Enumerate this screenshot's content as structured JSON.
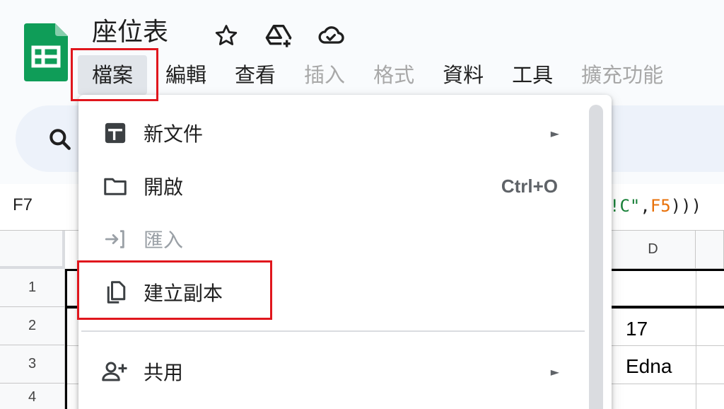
{
  "app": {
    "document_title": "座位表"
  },
  "header_icons": [
    "star-icon",
    "move-to-drive-icon",
    "cloud-saved-icon"
  ],
  "menubar": {
    "items": [
      {
        "label": "檔案",
        "state": "active"
      },
      {
        "label": "編輯",
        "state": "normal"
      },
      {
        "label": "查看",
        "state": "normal"
      },
      {
        "label": "插入",
        "state": "dim"
      },
      {
        "label": "格式",
        "state": "dim"
      },
      {
        "label": "資料",
        "state": "normal"
      },
      {
        "label": "工具",
        "state": "normal"
      },
      {
        "label": "擴充功能",
        "state": "dim"
      }
    ]
  },
  "formula_bar": {
    "name_box": "F7",
    "formula_parts": [
      {
        "text": "!C\"",
        "kind": "string"
      },
      {
        "text": ",",
        "kind": "plain"
      },
      {
        "text": "F5",
        "kind": "ref"
      },
      {
        "text": ")))",
        "kind": "plain"
      }
    ]
  },
  "grid": {
    "column_headers": [
      "D"
    ],
    "row_headers": [
      "1",
      "2",
      "3",
      "4"
    ],
    "cells": {
      "D2": "17",
      "D3": "Edna"
    }
  },
  "file_menu": {
    "items": [
      {
        "label": "新文件",
        "icon": "new-spreadsheet-icon",
        "shortcut": "",
        "submenu": true,
        "disabled": false
      },
      {
        "label": "開啟",
        "icon": "folder-icon",
        "shortcut": "Ctrl+O",
        "submenu": false,
        "disabled": false
      },
      {
        "label": "匯入",
        "icon": "import-icon",
        "shortcut": "",
        "submenu": false,
        "disabled": true
      },
      {
        "label": "建立副本",
        "icon": "copy-icon",
        "shortcut": "",
        "submenu": false,
        "disabled": false
      },
      {
        "label": "共用",
        "icon": "share-person-icon",
        "shortcut": "",
        "submenu": true,
        "disabled": false
      }
    ],
    "submenu_arrow": "►"
  },
  "colors": {
    "highlight_border": "#e0161d",
    "sheets_green": "#0f9d58",
    "formula_string": "#188038",
    "formula_reference": "#e8710a"
  }
}
